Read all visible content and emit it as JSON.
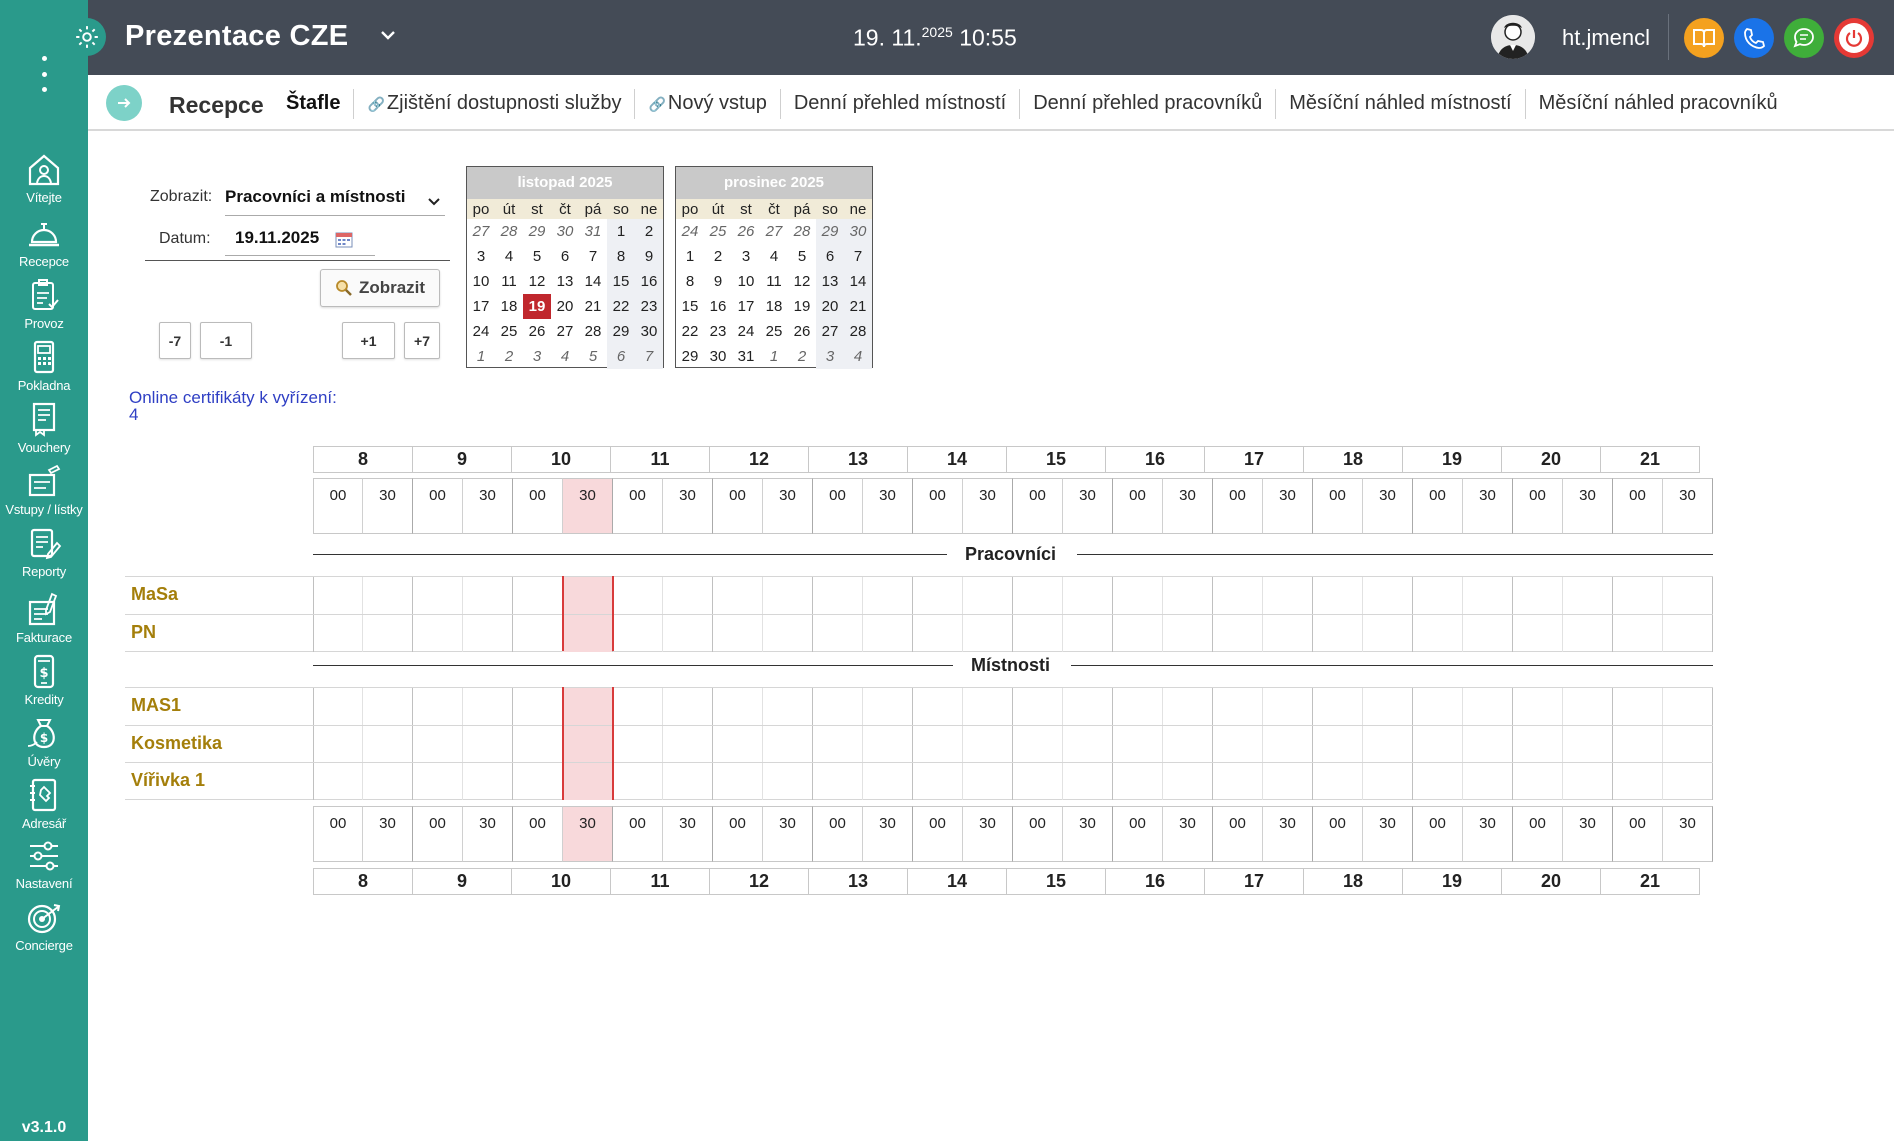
{
  "topbar": {
    "title": "Prezentace CZE",
    "date": "19. 11.",
    "year": "2025",
    "time": "10:55",
    "username": "ht.jmencl",
    "colors": {
      "bar": "#444b56",
      "book": "#f4a11f",
      "phone": "#1a73e8",
      "chat": "#3fae3a",
      "power": "#e53935"
    }
  },
  "sidebar": {
    "items": [
      {
        "label": "Vítejte",
        "icon": "home-icon"
      },
      {
        "label": "Recepce",
        "icon": "bell-icon"
      },
      {
        "label": "Provoz",
        "icon": "clipboard-icon"
      },
      {
        "label": "Pokladna",
        "icon": "cash-register-icon"
      },
      {
        "label": "Vouchery",
        "icon": "voucher-icon"
      },
      {
        "label": "Vstupy / lístky",
        "icon": "ticket-icon"
      },
      {
        "label": "Reporty",
        "icon": "report-icon"
      },
      {
        "label": "Fakturace",
        "icon": "invoice-icon"
      },
      {
        "label": "Kredity",
        "icon": "credit-phone-icon"
      },
      {
        "label": "Úvěry",
        "icon": "money-bag-icon"
      },
      {
        "label": "Adresář",
        "icon": "address-book-icon"
      },
      {
        "label": "Nastavení",
        "icon": "sliders-icon"
      },
      {
        "label": "Concierge",
        "icon": "target-icon"
      }
    ],
    "version": "v3.1.0",
    "color": "#2a9a8b"
  },
  "subnav": {
    "section": "Recepce",
    "tabs": [
      {
        "label": "Štafle",
        "active": true,
        "link": false
      },
      {
        "label": "Zjištění dostupnosti služby",
        "active": false,
        "link": true
      },
      {
        "label": "Nový vstup",
        "active": false,
        "link": true
      },
      {
        "label": "Denní přehled místností",
        "active": false,
        "link": false
      },
      {
        "label": "Denní přehled pracovníků",
        "active": false,
        "link": false
      },
      {
        "label": "Měsíční náhled místností",
        "active": false,
        "link": false
      },
      {
        "label": "Měsíční náhled pracovníků",
        "active": false,
        "link": false
      }
    ]
  },
  "filter": {
    "view_label": "Zobrazit:",
    "view_value": "Pracovníci a místnosti",
    "date_label": "Datum:",
    "date_value": "19.11.2025",
    "show_button": "Zobrazit",
    "steps": [
      "-7",
      "-1",
      "+1",
      "+7"
    ]
  },
  "calendars": [
    {
      "title": "listopad 2025",
      "weekdays": [
        "po",
        "út",
        "st",
        "čt",
        "pá",
        "so",
        "ne"
      ],
      "weeks": [
        [
          [
            "27",
            1
          ],
          [
            "28",
            1
          ],
          [
            "29",
            1
          ],
          [
            "30",
            1
          ],
          [
            "31",
            1
          ],
          [
            "1",
            0
          ],
          [
            "2",
            0
          ]
        ],
        [
          [
            "3",
            0
          ],
          [
            "4",
            0
          ],
          [
            "5",
            0
          ],
          [
            "6",
            0
          ],
          [
            "7",
            0
          ],
          [
            "8",
            0
          ],
          [
            "9",
            0
          ]
        ],
        [
          [
            "10",
            0
          ],
          [
            "11",
            0
          ],
          [
            "12",
            0
          ],
          [
            "13",
            0
          ],
          [
            "14",
            0
          ],
          [
            "15",
            0
          ],
          [
            "16",
            0
          ]
        ],
        [
          [
            "17",
            0
          ],
          [
            "18",
            0
          ],
          [
            "19",
            2
          ],
          [
            "20",
            0
          ],
          [
            "21",
            0
          ],
          [
            "22",
            0
          ],
          [
            "23",
            0
          ]
        ],
        [
          [
            "24",
            0
          ],
          [
            "25",
            0
          ],
          [
            "26",
            0
          ],
          [
            "27",
            0
          ],
          [
            "28",
            0
          ],
          [
            "29",
            0
          ],
          [
            "30",
            0
          ]
        ],
        [
          [
            "1",
            1
          ],
          [
            "2",
            1
          ],
          [
            "3",
            1
          ],
          [
            "4",
            1
          ],
          [
            "5",
            1
          ],
          [
            "6",
            1
          ],
          [
            "7",
            1
          ]
        ]
      ]
    },
    {
      "title": "prosinec 2025",
      "weekdays": [
        "po",
        "út",
        "st",
        "čt",
        "pá",
        "so",
        "ne"
      ],
      "weeks": [
        [
          [
            "24",
            1
          ],
          [
            "25",
            1
          ],
          [
            "26",
            1
          ],
          [
            "27",
            1
          ],
          [
            "28",
            1
          ],
          [
            "29",
            1
          ],
          [
            "30",
            1
          ]
        ],
        [
          [
            "1",
            0
          ],
          [
            "2",
            0
          ],
          [
            "3",
            0
          ],
          [
            "4",
            0
          ],
          [
            "5",
            0
          ],
          [
            "6",
            0
          ],
          [
            "7",
            0
          ]
        ],
        [
          [
            "8",
            0
          ],
          [
            "9",
            0
          ],
          [
            "10",
            0
          ],
          [
            "11",
            0
          ],
          [
            "12",
            0
          ],
          [
            "13",
            0
          ],
          [
            "14",
            0
          ]
        ],
        [
          [
            "15",
            0
          ],
          [
            "16",
            0
          ],
          [
            "17",
            0
          ],
          [
            "18",
            0
          ],
          [
            "19",
            0
          ],
          [
            "20",
            0
          ],
          [
            "21",
            0
          ]
        ],
        [
          [
            "22",
            0
          ],
          [
            "23",
            0
          ],
          [
            "24",
            0
          ],
          [
            "25",
            0
          ],
          [
            "26",
            0
          ],
          [
            "27",
            0
          ],
          [
            "28",
            0
          ]
        ],
        [
          [
            "29",
            0
          ],
          [
            "30",
            0
          ],
          [
            "31",
            0
          ],
          [
            "1",
            1
          ],
          [
            "2",
            1
          ],
          [
            "3",
            1
          ],
          [
            "4",
            1
          ]
        ]
      ]
    }
  ],
  "certificates": {
    "label": "Online certifikáty k vyřízení:",
    "count": "4"
  },
  "schedule": {
    "hours": [
      "8",
      "9",
      "10",
      "11",
      "12",
      "13",
      "14",
      "15",
      "16",
      "17",
      "18",
      "19",
      "20",
      "21"
    ],
    "halves": [
      "00",
      "30"
    ],
    "current_hour": "10",
    "current_half": "30",
    "groups": [
      {
        "title": "Pracovníci",
        "rows": [
          "MaSa",
          "PN"
        ]
      },
      {
        "title": "Místnosti",
        "rows": [
          "MAS1",
          "Kosmetika",
          "Vířivka 1"
        ]
      }
    ]
  }
}
